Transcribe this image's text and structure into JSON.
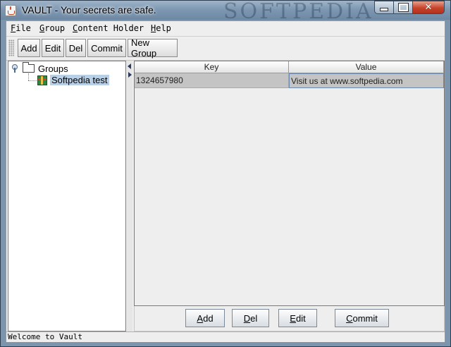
{
  "window": {
    "title": "VAULT - Your secrets are safe.",
    "watermark": "SOFTPEDIA",
    "controls": {
      "minimize": "minimize",
      "maximize": "maximize",
      "close": "✕"
    }
  },
  "menu": [
    "File",
    "Group",
    "Content Holder",
    "Help"
  ],
  "toolbar": {
    "add": "Add",
    "edit": "Edit",
    "del": "Del",
    "commit": "Commit",
    "new_group": "New Group"
  },
  "tree": {
    "root": "Groups",
    "children": [
      "Softpedia test"
    ]
  },
  "table": {
    "columns": [
      "Key",
      "Value"
    ],
    "rows": [
      {
        "key": "1324657980",
        "value": "Visit us at www.softpedia.com"
      }
    ]
  },
  "bottom_buttons": {
    "add": "Add",
    "del": "Del",
    "edit": "Edit",
    "commit": "Commit"
  },
  "status": "Welcome to Vault",
  "icons": [
    "java-app-icon",
    "tree-toggle-icon",
    "folder-icon",
    "group-node-icon",
    "collapse-left-icon",
    "collapse-right-icon"
  ]
}
